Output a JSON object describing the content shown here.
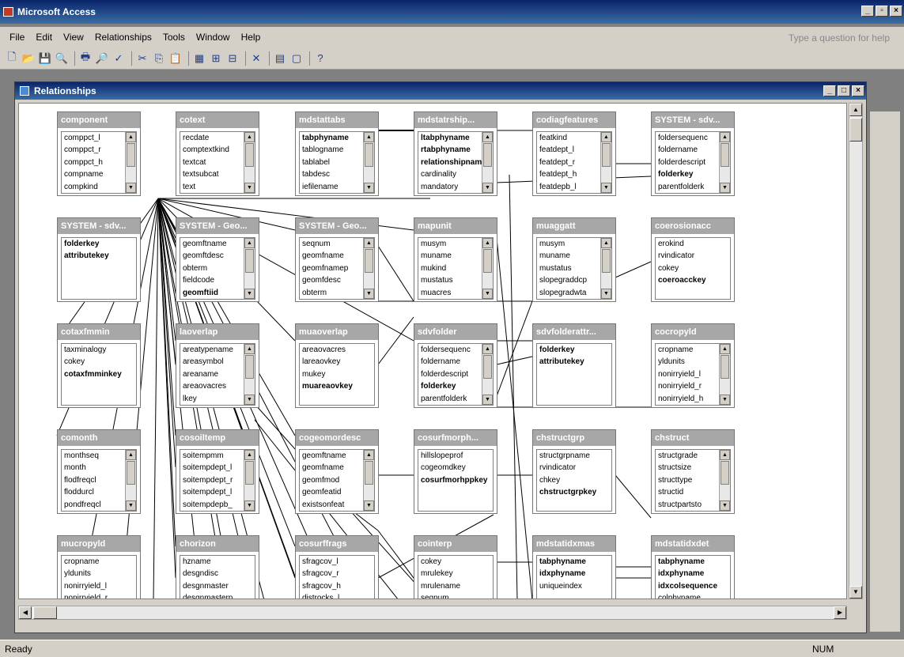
{
  "app": {
    "title": "Microsoft Access",
    "help_placeholder": "Type a question for help"
  },
  "menu": [
    "File",
    "Edit",
    "View",
    "Relationships",
    "Tools",
    "Window",
    "Help"
  ],
  "toolbar": [
    "new-icon",
    "open-icon",
    "save-icon",
    "search-icon",
    "print-icon",
    "print-preview-icon",
    "spelling-icon",
    "cut-icon",
    "copy-icon",
    "paste-icon",
    "show-table-icon",
    "show-direct-icon",
    "show-all-icon",
    "delete-icon",
    "database-window-icon",
    "new-object-icon",
    "help-icon"
  ],
  "relationships_window": {
    "title": "Relationships"
  },
  "tables": [
    {
      "name": "component",
      "fields": [
        {
          "n": "comppct_l"
        },
        {
          "n": "comppct_r"
        },
        {
          "n": "comppct_h"
        },
        {
          "n": "compname"
        },
        {
          "n": "compkind"
        }
      ]
    },
    {
      "name": "cotext",
      "fields": [
        {
          "n": "recdate"
        },
        {
          "n": "comptextkind"
        },
        {
          "n": "textcat"
        },
        {
          "n": "textsubcat"
        },
        {
          "n": "text"
        }
      ]
    },
    {
      "name": "mdstattabs",
      "fields": [
        {
          "n": "tabphyname",
          "k": true
        },
        {
          "n": "tablogname"
        },
        {
          "n": "tablabel"
        },
        {
          "n": "tabdesc"
        },
        {
          "n": "iefilename"
        }
      ]
    },
    {
      "name": "mdstatrship...",
      "fields": [
        {
          "n": "ltabphyname",
          "k": true
        },
        {
          "n": "rtabphyname",
          "k": true
        },
        {
          "n": "relationshipname",
          "k": true
        },
        {
          "n": "cardinality"
        },
        {
          "n": "mandatory"
        }
      ]
    },
    {
      "name": "codiagfeatures",
      "fields": [
        {
          "n": "featkind"
        },
        {
          "n": "featdept_l"
        },
        {
          "n": "featdept_r"
        },
        {
          "n": "featdept_h"
        },
        {
          "n": "featdepb_l"
        }
      ]
    },
    {
      "name": "SYSTEM - sdv...",
      "fields": [
        {
          "n": "foldersequenc"
        },
        {
          "n": "foldername"
        },
        {
          "n": "folderdescript"
        },
        {
          "n": "folderkey",
          "k": true
        },
        {
          "n": "parentfolderk"
        }
      ]
    },
    {
      "name": "SYSTEM - sdv...",
      "fields": [
        {
          "n": "folderkey",
          "k": true
        },
        {
          "n": "attributekey",
          "k": true
        }
      ]
    },
    {
      "name": "SYSTEM - Geo...",
      "fields": [
        {
          "n": "geomftname"
        },
        {
          "n": "geomftdesc"
        },
        {
          "n": "obterm"
        },
        {
          "n": "fieldcode"
        },
        {
          "n": "geomftiid",
          "k": true
        }
      ]
    },
    {
      "name": "SYSTEM - Geo...",
      "fields": [
        {
          "n": "seqnum"
        },
        {
          "n": "geomfname"
        },
        {
          "n": "geomfnamep"
        },
        {
          "n": "geomfdesc"
        },
        {
          "n": "obterm"
        }
      ]
    },
    {
      "name": "mapunit",
      "fields": [
        {
          "n": "musym"
        },
        {
          "n": "muname"
        },
        {
          "n": "mukind"
        },
        {
          "n": "mustatus"
        },
        {
          "n": "muacres"
        }
      ]
    },
    {
      "name": "muaggatt",
      "fields": [
        {
          "n": "musym"
        },
        {
          "n": "muname"
        },
        {
          "n": "mustatus"
        },
        {
          "n": "slopegraddcp"
        },
        {
          "n": "slopegradwta"
        }
      ]
    },
    {
      "name": "coerosionacc",
      "fields": [
        {
          "n": "erokind"
        },
        {
          "n": "rvindicator"
        },
        {
          "n": "cokey"
        },
        {
          "n": "coeroacckey",
          "k": true
        }
      ]
    },
    {
      "name": "cotaxfmmin",
      "fields": [
        {
          "n": "taxminalogy"
        },
        {
          "n": "cokey"
        },
        {
          "n": "cotaxfmminkey",
          "k": true
        }
      ]
    },
    {
      "name": "laoverlap",
      "fields": [
        {
          "n": "areatypename"
        },
        {
          "n": "areasymbol"
        },
        {
          "n": "areaname"
        },
        {
          "n": "areaovacres"
        },
        {
          "n": "lkey"
        }
      ]
    },
    {
      "name": "muaoverlap",
      "fields": [
        {
          "n": "areaovacres"
        },
        {
          "n": "lareaovkey"
        },
        {
          "n": "mukey"
        },
        {
          "n": "muareaovkey",
          "k": true
        }
      ]
    },
    {
      "name": "sdvfolder",
      "fields": [
        {
          "n": "foldersequenc"
        },
        {
          "n": "foldername"
        },
        {
          "n": "folderdescript"
        },
        {
          "n": "folderkey",
          "k": true
        },
        {
          "n": "parentfolderk"
        }
      ]
    },
    {
      "name": "sdvfolderattr...",
      "fields": [
        {
          "n": "folderkey",
          "k": true
        },
        {
          "n": "attributekey",
          "k": true
        }
      ]
    },
    {
      "name": "cocropyld",
      "fields": [
        {
          "n": "cropname"
        },
        {
          "n": "yldunits"
        },
        {
          "n": "nonirryield_l"
        },
        {
          "n": "nonirryield_r"
        },
        {
          "n": "nonirryield_h"
        }
      ]
    },
    {
      "name": "comonth",
      "fields": [
        {
          "n": "monthseq"
        },
        {
          "n": "month"
        },
        {
          "n": "flodfreqcl"
        },
        {
          "n": "floddurcl"
        },
        {
          "n": "pondfreqcl"
        }
      ]
    },
    {
      "name": "cosoiltemp",
      "fields": [
        {
          "n": "soitempmm"
        },
        {
          "n": "soitempdept_l"
        },
        {
          "n": "soitempdept_r"
        },
        {
          "n": "soitempdept_l"
        },
        {
          "n": "soitempdepb_"
        }
      ]
    },
    {
      "name": "cogeomordesc",
      "fields": [
        {
          "n": "geomftname"
        },
        {
          "n": "geomfname"
        },
        {
          "n": "geomfmod"
        },
        {
          "n": "geomfeatid"
        },
        {
          "n": "existsonfeat"
        }
      ]
    },
    {
      "name": "cosurfmorph...",
      "fields": [
        {
          "n": "hillslopeprof"
        },
        {
          "n": "cogeomdkey"
        },
        {
          "n": "cosurfmorhppkey",
          "k": true
        }
      ]
    },
    {
      "name": "chstructgrp",
      "fields": [
        {
          "n": "structgrpname"
        },
        {
          "n": "rvindicator"
        },
        {
          "n": "chkey"
        },
        {
          "n": "chstructgrpkey",
          "k": true
        }
      ]
    },
    {
      "name": "chstruct",
      "fields": [
        {
          "n": "structgrade"
        },
        {
          "n": "structsize"
        },
        {
          "n": "structtype"
        },
        {
          "n": "structid"
        },
        {
          "n": "structpartsto"
        }
      ]
    },
    {
      "name": "mucropyld",
      "fields": [
        {
          "n": "cropname"
        },
        {
          "n": "yldunits"
        },
        {
          "n": "nonirryield_l"
        },
        {
          "n": "nonirryield_r"
        }
      ]
    },
    {
      "name": "chorizon",
      "fields": [
        {
          "n": "hzname"
        },
        {
          "n": "desgndisc"
        },
        {
          "n": "desgnmaster"
        },
        {
          "n": "desgnmasterp"
        }
      ]
    },
    {
      "name": "cosurffrags",
      "fields": [
        {
          "n": "sfragcov_l"
        },
        {
          "n": "sfragcov_r"
        },
        {
          "n": "sfragcov_h"
        },
        {
          "n": "distrocks_l"
        }
      ]
    },
    {
      "name": "cointerp",
      "fields": [
        {
          "n": "cokey"
        },
        {
          "n": "mrulekey"
        },
        {
          "n": "mrulename"
        },
        {
          "n": "seqnum"
        }
      ]
    },
    {
      "name": "mdstatidxmas",
      "fields": [
        {
          "n": "tabphyname",
          "k": true
        },
        {
          "n": "idxphyname",
          "k": true
        },
        {
          "n": "uniqueindex"
        }
      ]
    },
    {
      "name": "mdstatidxdet",
      "fields": [
        {
          "n": "tabphyname",
          "k": true
        },
        {
          "n": "idxphyname",
          "k": true
        },
        {
          "n": "idxcolsequence",
          "k": true
        },
        {
          "n": "colphyname"
        }
      ]
    }
  ],
  "status": {
    "left": "Ready",
    "num": "NUM"
  }
}
